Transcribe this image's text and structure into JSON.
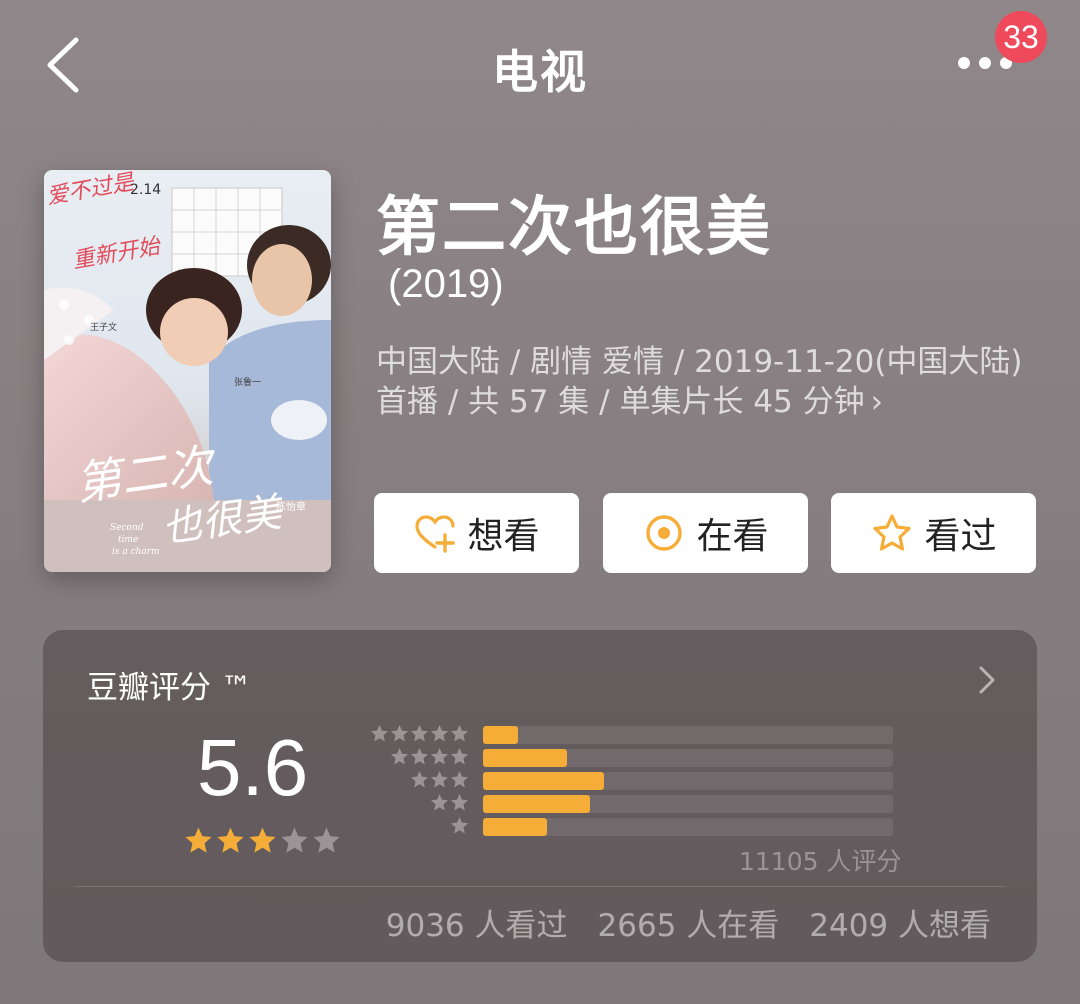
{
  "nav": {
    "title": "电视",
    "badge_count": "33",
    "icons": {
      "back": "chevron-left-icon",
      "more": "more-dots-icon"
    }
  },
  "poster": {
    "artwork_text": [
      "爱不过是重新开始",
      "2.14",
      "第二次也很美",
      "Second time is a charm",
      "王子文",
      "张鲁一",
      "陈怡章"
    ]
  },
  "show": {
    "title": "第二次也很美",
    "year": "(2019)",
    "meta_line1": "中国大陆 / 剧情 爱情 / 2019-11-20(中国大陆)",
    "meta_line2": "首播 / 共 57 集 / 单集片长 45 分钟",
    "meta_chevron": "›"
  },
  "actions": {
    "want": {
      "label": "想看",
      "icon": "heart-plus-icon"
    },
    "watching": {
      "label": "在看",
      "icon": "target-circle-icon"
    },
    "watched": {
      "label": "看过",
      "icon": "star-outline-icon"
    }
  },
  "rating": {
    "heading": "豆瓣评分 ™",
    "score": "5.6",
    "score_stars": 3,
    "vote_text": "11105 人评分",
    "distribution": [
      {
        "stars": 5,
        "fraction": 0.085
      },
      {
        "stars": 4,
        "fraction": 0.205
      },
      {
        "stars": 3,
        "fraction": 0.295
      },
      {
        "stars": 2,
        "fraction": 0.26
      },
      {
        "stars": 1,
        "fraction": 0.155
      }
    ],
    "stats": {
      "watched": "9036 人看过",
      "watching": "2665 人在看",
      "want": "2409 人想看"
    }
  },
  "colors": {
    "accent": "#f6ad38",
    "badge": "#ef4a5b",
    "star_inactive": "#9a9496",
    "star_active": "#f6ad38"
  }
}
